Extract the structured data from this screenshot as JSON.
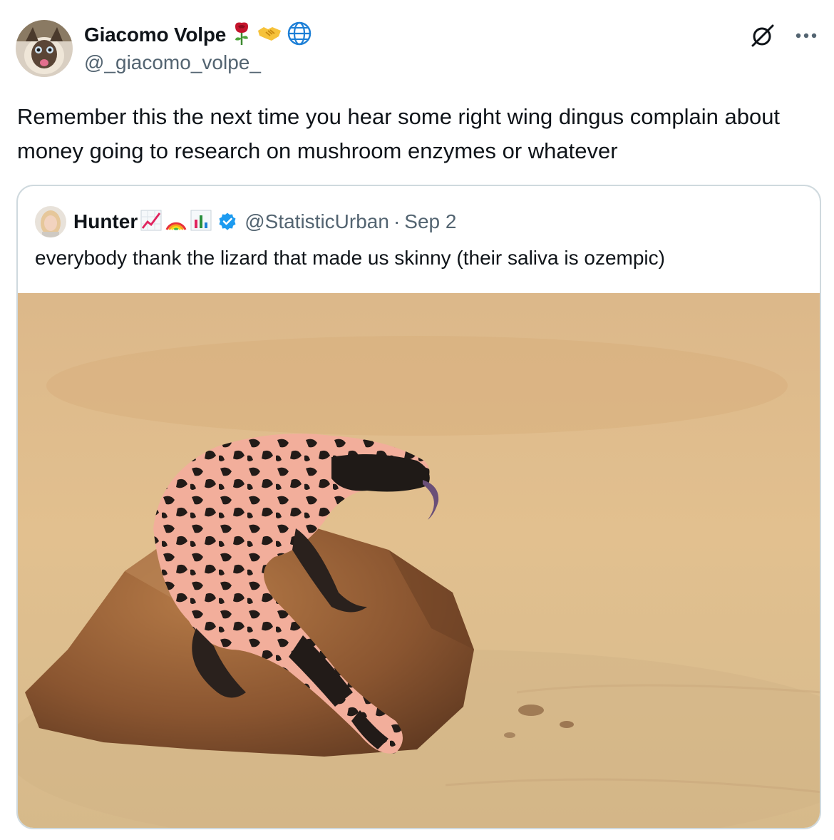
{
  "tweet": {
    "author": {
      "display_name": "Giacomo Volpe",
      "handle": "@_giacomo_volpe_",
      "name_emojis": [
        "rose-icon",
        "handshake-icon",
        "globe-icon"
      ]
    },
    "text": "Remember this the next time you hear some right wing dingus complain about money going to research on mushroom enzymes or whatever",
    "actions": [
      "grok-icon",
      "more-icon"
    ]
  },
  "quoted_tweet": {
    "author": {
      "display_name": "Hunter",
      "name_emojis": [
        "chart-increasing-icon",
        "rainbow-icon",
        "bar-chart-icon"
      ],
      "verified": true,
      "handle": "@StatisticUrban"
    },
    "separator": "·",
    "date": "Sep 2",
    "text": "everybody thank the lizard that made us skinny (their saliva is ozempic)",
    "media": "gila-monster-on-rock-photo"
  },
  "colors": {
    "text_primary": "#0f1419",
    "text_secondary": "#536471",
    "border": "#cfd9de",
    "verified_blue": "#1d9bf0"
  }
}
